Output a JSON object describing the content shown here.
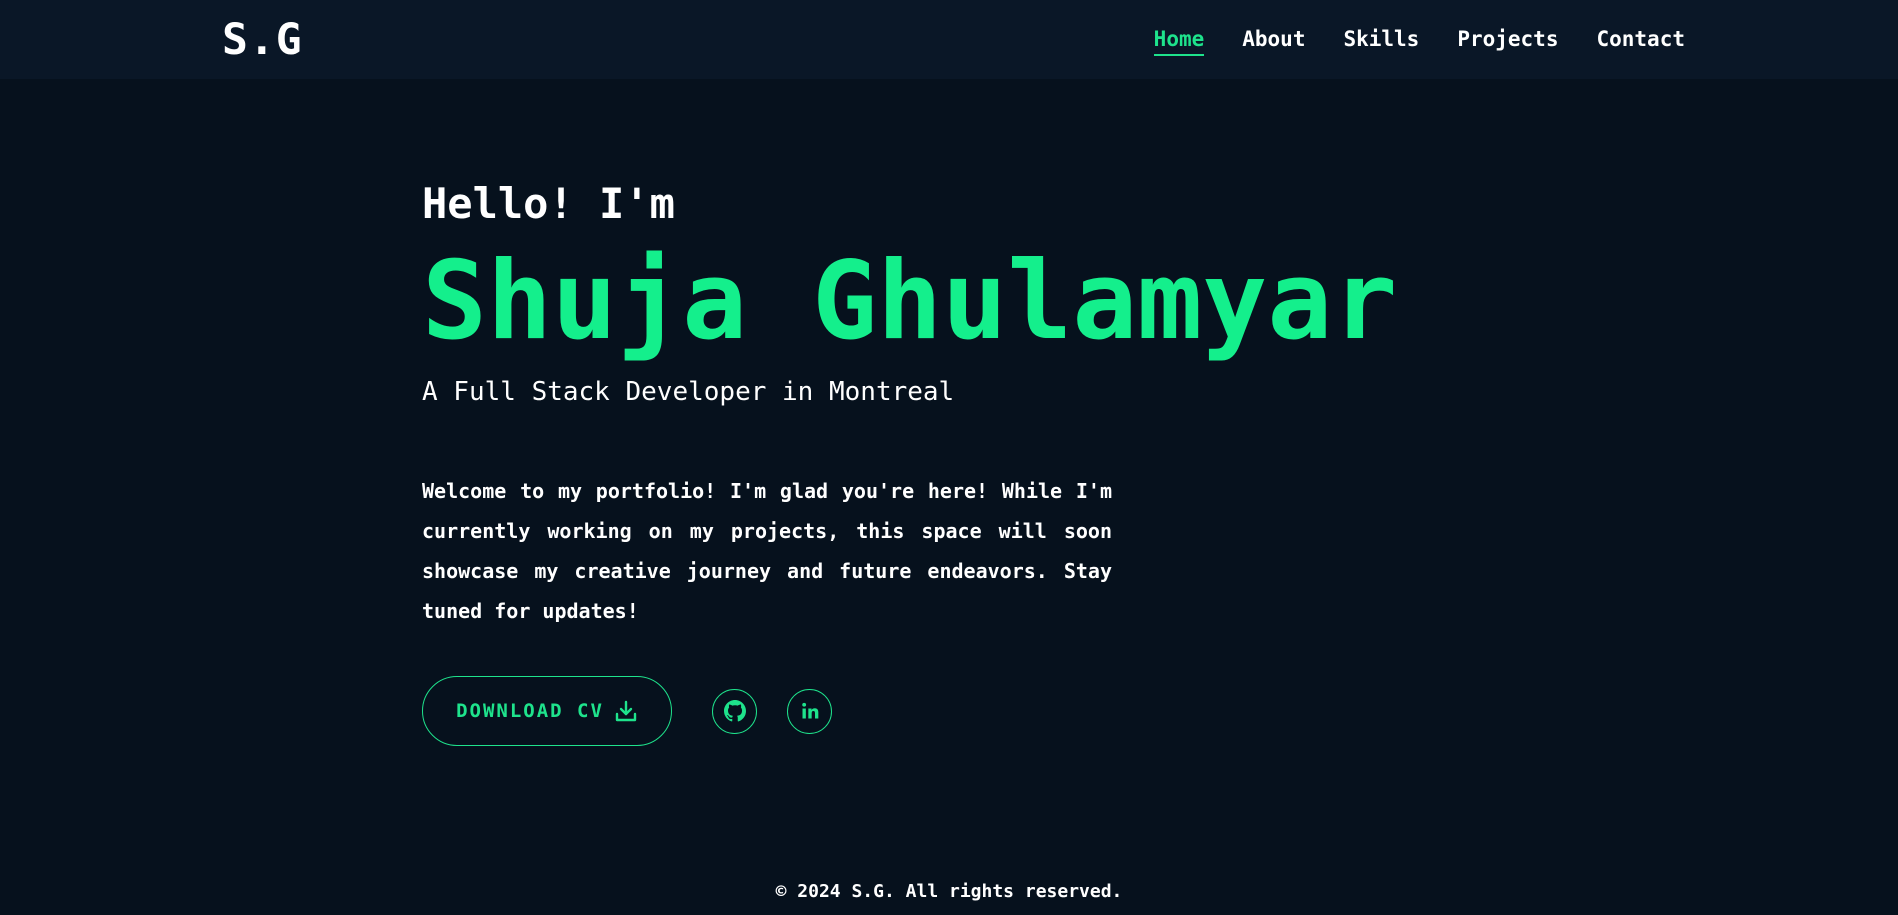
{
  "nav": {
    "logo": "S.G",
    "links": [
      "Home",
      "About",
      "Skills",
      "Projects",
      "Contact"
    ],
    "active": "Home"
  },
  "hero": {
    "greeting": "Hello! I'm",
    "name": "Shuja Ghulamyar",
    "subtitle": "A Full Stack Developer in Montreal",
    "intro": "Welcome to my portfolio! I'm glad you're here! While I'm currently working on my projects, this space will soon showcase my creative journey and future endeavors. Stay tuned for updates!"
  },
  "actions": {
    "cv_label": "DOWNLOAD CV",
    "cv_icon": "download-icon",
    "social_icons": [
      "github-icon",
      "linkedin-icon"
    ]
  },
  "footer": {
    "text": "© 2024 S.G. All rights reserved."
  },
  "colors": {
    "background": "#06111d",
    "navbar": "#0a1727",
    "accent": "#1ee38c",
    "text": "#ffffff"
  }
}
